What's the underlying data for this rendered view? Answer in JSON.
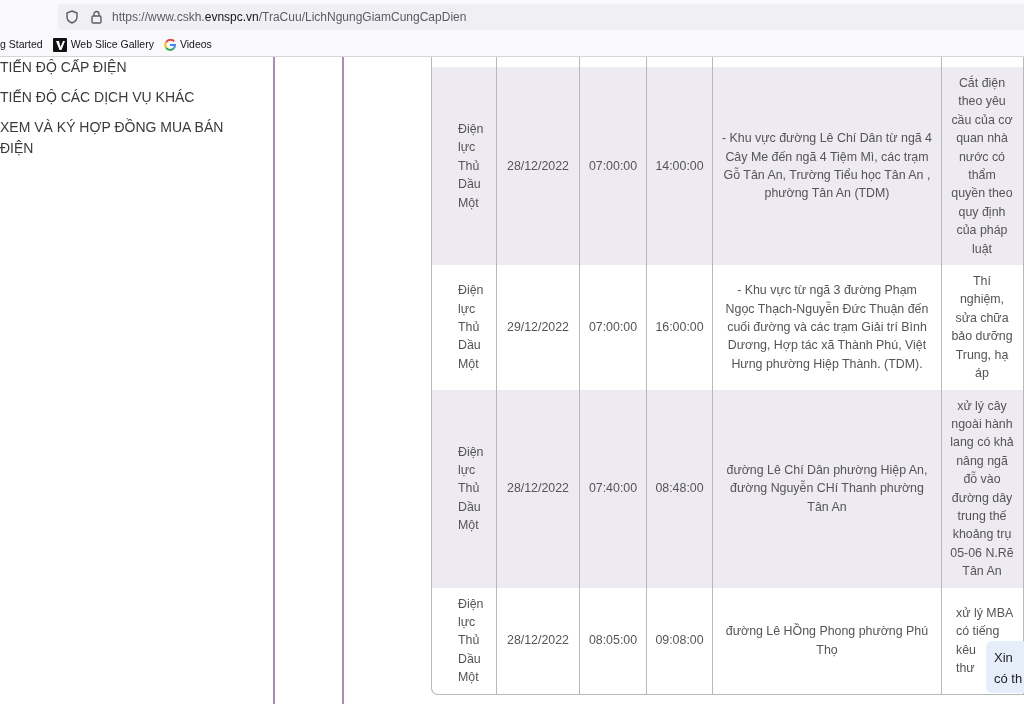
{
  "browser": {
    "url": {
      "host_prefix": "https://www.cskh.",
      "domain": "evnspc.vn",
      "path": "/TraCuu/LichNgungGiamCungCapDien"
    },
    "bookmarks": [
      {
        "label": "g Started",
        "kind": "plain"
      },
      {
        "label": "Web Slice Gallery",
        "kind": "slice"
      },
      {
        "label": "Videos",
        "kind": "google"
      }
    ]
  },
  "sidebar": {
    "items": [
      {
        "label": "TIẾN ĐỘ CẤP ĐIỆN"
      },
      {
        "label": "TIẾN ĐỘ CÁC DỊCH VỤ KHÁC"
      },
      {
        "label": "XEM VÀ KÝ HỢP ĐỒNG MUA BÁN ĐIỆN"
      }
    ]
  },
  "table": {
    "rows": [
      {
        "cells": [
          "Điện lực Thủ Dầu Một",
          "28/12/2022",
          "07:00:00",
          "14:00:00",
          "- Khu vực đường Lê Chí Dân từ ngã 4 Cây Me đến ngã 4 Tiệm Mì, các trạm Gỗ Tân An, Trường Tiểu học Tân An , phường Tân An (TDM)",
          "Cắt điện theo yêu cầu của cơ quan nhà nước có thẩm quyền theo quy định của pháp luật"
        ]
      },
      {
        "cells": [
          "Điện lực Thủ Dầu Một",
          "29/12/2022",
          "07:00:00",
          "16:00:00",
          "- Khu vực từ ngã 3 đường Phạm Ngọc Thạch-Nguyễn Đức Thuận đến cuối đường và các trạm Giải trí Bình Dương, Hợp tác xã Thành Phú, Việt Hưng phường Hiệp Thành. (TDM).",
          "Thí nghiệm, sửa chữa bảo dưỡng Trung, hạ áp"
        ]
      },
      {
        "cells": [
          "Điện lực Thủ Dầu Một",
          "28/12/2022",
          "07:40:00",
          "08:48:00",
          "đường Lê Chí Dân phường Hiệp An, đường Nguyễn CHí Thanh phường Tân An",
          "xử lý cây ngoài hành lang có khả nâng ngã đỗ vào đường dây trung thế khoảng trụ 05-06 N.Rẽ Tân An"
        ]
      },
      {
        "cells": [
          "Điện lực Thủ Dầu Một",
          "28/12/2022",
          "08:05:00",
          "09:08:00",
          "đường Lê HỒng Phong phường Phú Thọ",
          {
            "lines": [
              "xử lý MBA",
              "có tiếng",
              "kêu",
              "thư"
            ]
          }
        ]
      }
    ]
  },
  "chat_popup": {
    "text": "Xin có th"
  }
}
